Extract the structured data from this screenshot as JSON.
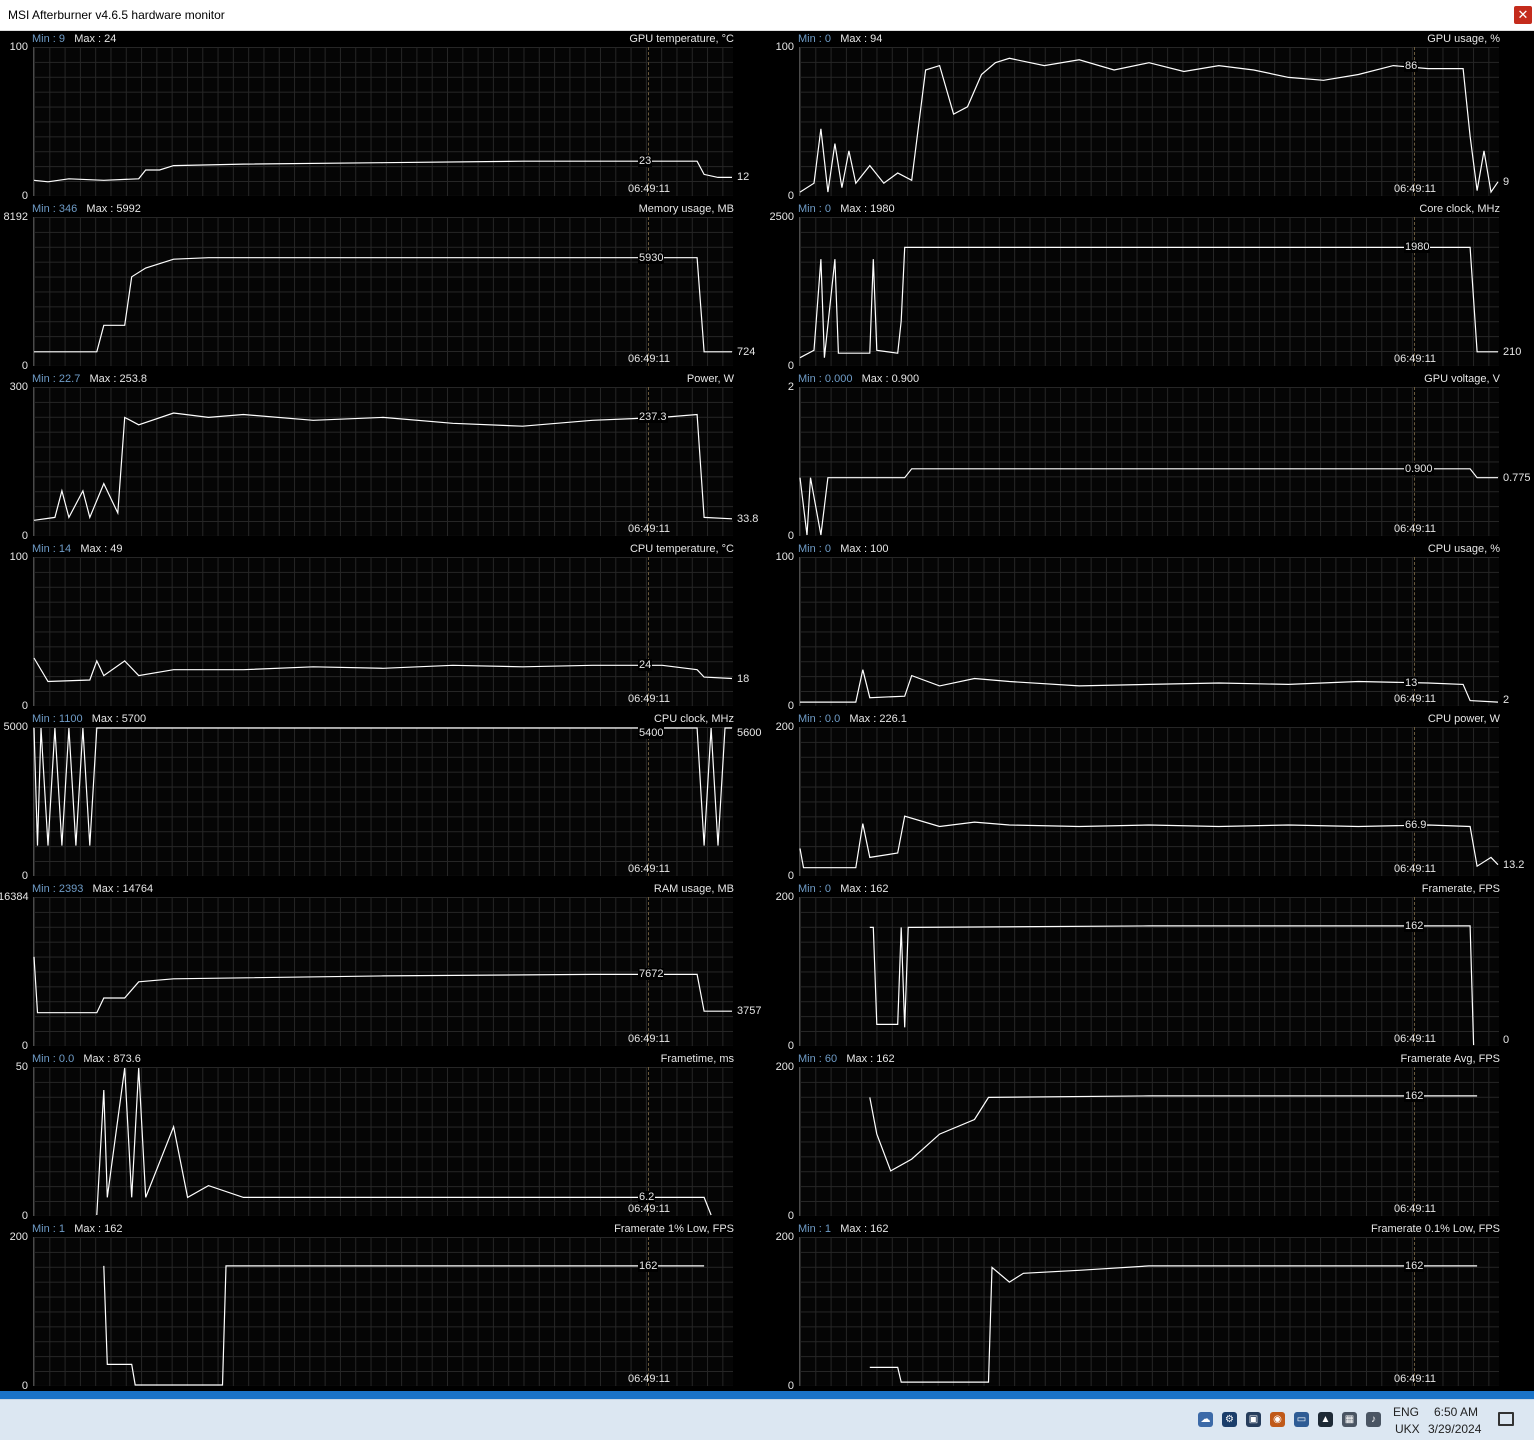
{
  "window": {
    "title": "MSI Afterburner v4.6.5 hardware monitor",
    "close_glyph": "✕"
  },
  "colors": {
    "trace": "#ffffff",
    "minmax_label": "#6f9cc7",
    "text": "#e6e6e6",
    "grid": "#262626",
    "taskbar": "#dce7f2",
    "accent_strip": "#1a73c8"
  },
  "timestamp": "06:49:11",
  "graphs": [
    {
      "title": "GPU temperature, °C",
      "min": "9",
      "max": "24",
      "scale_max": "100",
      "scale_min": "0",
      "current": "23",
      "last": "12",
      "trace": [
        [
          0,
          10
        ],
        [
          0.02,
          9
        ],
        [
          0.05,
          11
        ],
        [
          0.1,
          10
        ],
        [
          0.15,
          11
        ],
        [
          0.16,
          17
        ],
        [
          0.18,
          17
        ],
        [
          0.2,
          20
        ],
        [
          0.3,
          21
        ],
        [
          0.5,
          22
        ],
        [
          0.7,
          23
        ],
        [
          0.88,
          23
        ],
        [
          0.95,
          23
        ],
        [
          0.96,
          14
        ],
        [
          0.98,
          12
        ],
        [
          1,
          12
        ]
      ]
    },
    {
      "title": "GPU usage, %",
      "min": "0",
      "max": "94",
      "scale_max": "100",
      "scale_min": "0",
      "current": "86",
      "last": "9",
      "trace": [
        [
          0,
          2
        ],
        [
          0.02,
          8
        ],
        [
          0.03,
          45
        ],
        [
          0.04,
          2
        ],
        [
          0.05,
          35
        ],
        [
          0.06,
          5
        ],
        [
          0.07,
          30
        ],
        [
          0.08,
          8
        ],
        [
          0.1,
          20
        ],
        [
          0.12,
          8
        ],
        [
          0.14,
          15
        ],
        [
          0.16,
          10
        ],
        [
          0.18,
          85
        ],
        [
          0.2,
          88
        ],
        [
          0.22,
          55
        ],
        [
          0.24,
          60
        ],
        [
          0.26,
          82
        ],
        [
          0.28,
          90
        ],
        [
          0.3,
          93
        ],
        [
          0.35,
          88
        ],
        [
          0.4,
          92
        ],
        [
          0.45,
          85
        ],
        [
          0.5,
          90
        ],
        [
          0.55,
          84
        ],
        [
          0.6,
          88
        ],
        [
          0.65,
          85
        ],
        [
          0.7,
          80
        ],
        [
          0.75,
          78
        ],
        [
          0.8,
          82
        ],
        [
          0.85,
          88
        ],
        [
          0.9,
          86
        ],
        [
          0.95,
          86
        ],
        [
          0.96,
          40
        ],
        [
          0.97,
          3
        ],
        [
          0.98,
          30
        ],
        [
          0.99,
          2
        ],
        [
          1,
          9
        ]
      ]
    },
    {
      "title": "Memory usage, MB",
      "min": "346",
      "max": "5992",
      "scale_max": "8192",
      "scale_min": "0",
      "current": "5930",
      "last": "724",
      "trace": [
        [
          0,
          0.09
        ],
        [
          0.09,
          0.09
        ],
        [
          0.1,
          0.27
        ],
        [
          0.13,
          0.27
        ],
        [
          0.14,
          0.6
        ],
        [
          0.16,
          0.66
        ],
        [
          0.2,
          0.72
        ],
        [
          0.25,
          0.73
        ],
        [
          0.5,
          0.73
        ],
        [
          0.7,
          0.73
        ],
        [
          0.92,
          0.73
        ],
        [
          0.95,
          0.73
        ],
        [
          0.96,
          0.09
        ],
        [
          1,
          0.09
        ]
      ]
    },
    {
      "title": "Core clock, MHz",
      "min": "0",
      "max": "1980",
      "scale_max": "2500",
      "scale_min": "0",
      "current": "1980",
      "last": "210",
      "trace": [
        [
          0,
          0.05
        ],
        [
          0.02,
          0.1
        ],
        [
          0.03,
          0.72
        ],
        [
          0.035,
          0.05
        ],
        [
          0.05,
          0.72
        ],
        [
          0.055,
          0.08
        ],
        [
          0.1,
          0.08
        ],
        [
          0.105,
          0.72
        ],
        [
          0.11,
          0.1
        ],
        [
          0.14,
          0.08
        ],
        [
          0.145,
          0.3
        ],
        [
          0.15,
          0.8
        ],
        [
          0.16,
          0.8
        ],
        [
          0.5,
          0.8
        ],
        [
          0.9,
          0.8
        ],
        [
          0.96,
          0.8
        ],
        [
          0.97,
          0.09
        ],
        [
          1,
          0.09
        ]
      ]
    },
    {
      "title": "Power, W",
      "min": "22.7",
      "max": "253.8",
      "scale_max": "300",
      "scale_min": "0",
      "current": "237.3",
      "last": "33.8",
      "trace": [
        [
          0,
          0.1
        ],
        [
          0.03,
          0.12
        ],
        [
          0.04,
          0.3
        ],
        [
          0.05,
          0.12
        ],
        [
          0.07,
          0.3
        ],
        [
          0.08,
          0.12
        ],
        [
          0.1,
          0.35
        ],
        [
          0.12,
          0.15
        ],
        [
          0.13,
          0.8
        ],
        [
          0.15,
          0.75
        ],
        [
          0.2,
          0.83
        ],
        [
          0.25,
          0.8
        ],
        [
          0.3,
          0.82
        ],
        [
          0.4,
          0.78
        ],
        [
          0.5,
          0.8
        ],
        [
          0.6,
          0.76
        ],
        [
          0.7,
          0.74
        ],
        [
          0.8,
          0.78
        ],
        [
          0.9,
          0.8
        ],
        [
          0.95,
          0.82
        ],
        [
          0.96,
          0.12
        ],
        [
          1,
          0.11
        ]
      ]
    },
    {
      "title": "GPU voltage, V",
      "min": "0.000",
      "max": "0.900",
      "scale_max": "2",
      "scale_min": "0",
      "current": "0.900",
      "last": "0.775",
      "trace": [
        [
          0,
          0.39
        ],
        [
          0.01,
          0.0
        ],
        [
          0.015,
          0.39
        ],
        [
          0.03,
          0.0
        ],
        [
          0.04,
          0.39
        ],
        [
          0.06,
          0.39
        ],
        [
          0.15,
          0.39
        ],
        [
          0.16,
          0.45
        ],
        [
          0.5,
          0.45
        ],
        [
          0.96,
          0.45
        ],
        [
          0.97,
          0.39
        ],
        [
          1,
          0.39
        ]
      ]
    },
    {
      "title": "CPU temperature, °C",
      "min": "14",
      "max": "49",
      "scale_max": "100",
      "scale_min": "0",
      "current": "24",
      "last": "18",
      "trace": [
        [
          0,
          0.32
        ],
        [
          0.02,
          0.16
        ],
        [
          0.08,
          0.17
        ],
        [
          0.09,
          0.3
        ],
        [
          0.1,
          0.2
        ],
        [
          0.13,
          0.3
        ],
        [
          0.15,
          0.2
        ],
        [
          0.2,
          0.24
        ],
        [
          0.3,
          0.24
        ],
        [
          0.4,
          0.26
        ],
        [
          0.5,
          0.25
        ],
        [
          0.6,
          0.27
        ],
        [
          0.7,
          0.26
        ],
        [
          0.8,
          0.27
        ],
        [
          0.9,
          0.27
        ],
        [
          0.95,
          0.24
        ],
        [
          0.96,
          0.19
        ],
        [
          1,
          0.18
        ]
      ]
    },
    {
      "title": "CPU usage, %",
      "min": "0",
      "max": "100",
      "scale_max": "100",
      "scale_min": "0",
      "current": "13",
      "last": "2",
      "trace": [
        [
          0,
          0.02
        ],
        [
          0.08,
          0.02
        ],
        [
          0.09,
          0.24
        ],
        [
          0.1,
          0.05
        ],
        [
          0.15,
          0.06
        ],
        [
          0.16,
          0.2
        ],
        [
          0.2,
          0.13
        ],
        [
          0.25,
          0.18
        ],
        [
          0.3,
          0.16
        ],
        [
          0.4,
          0.13
        ],
        [
          0.5,
          0.14
        ],
        [
          0.6,
          0.15
        ],
        [
          0.7,
          0.14
        ],
        [
          0.8,
          0.16
        ],
        [
          0.9,
          0.15
        ],
        [
          0.95,
          0.14
        ],
        [
          0.96,
          0.03
        ],
        [
          1,
          0.02
        ]
      ]
    },
    {
      "title": "CPU clock, MHz",
      "min": "1100",
      "max": "5700",
      "scale_max": "5000",
      "scale_min": "0",
      "current": "5400",
      "last": "5600",
      "trace": [
        [
          0,
          1
        ],
        [
          0.005,
          0.2
        ],
        [
          0.01,
          1
        ],
        [
          0.02,
          0.2
        ],
        [
          0.03,
          1
        ],
        [
          0.04,
          0.2
        ],
        [
          0.05,
          1
        ],
        [
          0.06,
          0.2
        ],
        [
          0.07,
          1
        ],
        [
          0.08,
          0.2
        ],
        [
          0.09,
          1
        ],
        [
          0.1,
          1
        ],
        [
          0.5,
          1
        ],
        [
          0.95,
          1
        ],
        [
          0.96,
          0.2
        ],
        [
          0.97,
          1
        ],
        [
          0.98,
          0.2
        ],
        [
          0.99,
          1
        ],
        [
          1,
          1
        ]
      ]
    },
    {
      "title": "CPU power, W",
      "min": "0.0",
      "max": "226.1",
      "scale_max": "200",
      "scale_min": "0",
      "current": "66.9",
      "last": "13.2",
      "trace": [
        [
          0,
          0.18
        ],
        [
          0.005,
          0.05
        ],
        [
          0.08,
          0.05
        ],
        [
          0.09,
          0.35
        ],
        [
          0.1,
          0.12
        ],
        [
          0.14,
          0.15
        ],
        [
          0.15,
          0.4
        ],
        [
          0.2,
          0.33
        ],
        [
          0.25,
          0.36
        ],
        [
          0.3,
          0.34
        ],
        [
          0.4,
          0.33
        ],
        [
          0.5,
          0.34
        ],
        [
          0.6,
          0.33
        ],
        [
          0.7,
          0.34
        ],
        [
          0.8,
          0.33
        ],
        [
          0.9,
          0.34
        ],
        [
          0.96,
          0.33
        ],
        [
          0.97,
          0.06
        ],
        [
          0.99,
          0.12
        ],
        [
          1,
          0.07
        ]
      ]
    },
    {
      "title": "RAM usage, MB",
      "min": "2393",
      "max": "14764",
      "scale_max": "16384",
      "scale_min": "0",
      "current": "7672",
      "last": "3757",
      "trace": [
        [
          0,
          0.6
        ],
        [
          0.005,
          0.22
        ],
        [
          0.09,
          0.22
        ],
        [
          0.1,
          0.32
        ],
        [
          0.13,
          0.32
        ],
        [
          0.15,
          0.43
        ],
        [
          0.2,
          0.45
        ],
        [
          0.5,
          0.47
        ],
        [
          0.8,
          0.48
        ],
        [
          0.95,
          0.48
        ],
        [
          0.96,
          0.23
        ],
        [
          1,
          0.23
        ]
      ]
    },
    {
      "title": "Framerate, FPS",
      "min": "0",
      "max": "162",
      "scale_max": "200",
      "scale_min": "0",
      "current": "162",
      "last": "0",
      "trace": [
        [
          0.1,
          0.8
        ],
        [
          0.105,
          0.8
        ],
        [
          0.11,
          0.14
        ],
        [
          0.14,
          0.14
        ],
        [
          0.145,
          0.8
        ],
        [
          0.15,
          0.12
        ],
        [
          0.155,
          0.8
        ],
        [
          0.16,
          0.8
        ],
        [
          0.5,
          0.81
        ],
        [
          0.9,
          0.81
        ],
        [
          0.96,
          0.81
        ],
        [
          0.965,
          0.0
        ]
      ]
    },
    {
      "title": "Frametime, ms",
      "min": "0.0",
      "max": "873.6",
      "scale_max": "50",
      "scale_min": "0",
      "current": "6.2",
      "last": "",
      "trace": [
        [
          0.09,
          0.0
        ],
        [
          0.1,
          0.85
        ],
        [
          0.105,
          0.12
        ],
        [
          0.13,
          1
        ],
        [
          0.14,
          0.12
        ],
        [
          0.15,
          1
        ],
        [
          0.16,
          0.12
        ],
        [
          0.2,
          0.6
        ],
        [
          0.22,
          0.12
        ],
        [
          0.25,
          0.2
        ],
        [
          0.3,
          0.12
        ],
        [
          0.5,
          0.12
        ],
        [
          0.8,
          0.12
        ],
        [
          0.96,
          0.12
        ],
        [
          0.97,
          0.0
        ]
      ]
    },
    {
      "title": "Framerate Avg, FPS",
      "min": "60",
      "max": "162",
      "scale_max": "200",
      "scale_min": "0",
      "current": "162",
      "last": "",
      "trace": [
        [
          0.1,
          0.8
        ],
        [
          0.11,
          0.55
        ],
        [
          0.13,
          0.3
        ],
        [
          0.16,
          0.38
        ],
        [
          0.2,
          0.55
        ],
        [
          0.25,
          0.65
        ],
        [
          0.27,
          0.8
        ],
        [
          0.5,
          0.81
        ],
        [
          0.97,
          0.81
        ]
      ]
    },
    {
      "title": "Framerate 1% Low, FPS",
      "min": "1",
      "max": "162",
      "scale_max": "200",
      "scale_min": "0",
      "current": "162",
      "last": "",
      "trace": [
        [
          0.1,
          0.81
        ],
        [
          0.105,
          0.14
        ],
        [
          0.14,
          0.14
        ],
        [
          0.145,
          0.0
        ],
        [
          0.27,
          0.0
        ],
        [
          0.275,
          0.81
        ],
        [
          0.96,
          0.81
        ]
      ]
    },
    {
      "title": "Framerate 0.1% Low, FPS",
      "min": "1",
      "max": "162",
      "scale_max": "200",
      "scale_min": "0",
      "current": "162",
      "last": "",
      "trace": [
        [
          0.1,
          0.12
        ],
        [
          0.14,
          0.12
        ],
        [
          0.145,
          0.02
        ],
        [
          0.27,
          0.02
        ],
        [
          0.275,
          0.8
        ],
        [
          0.3,
          0.7
        ],
        [
          0.32,
          0.76
        ],
        [
          0.4,
          0.78
        ],
        [
          0.5,
          0.81
        ],
        [
          0.97,
          0.81
        ]
      ]
    }
  ],
  "taskbar": {
    "lang": "ENG",
    "layout": "UKX",
    "time": "6:50 AM",
    "date": "3/29/2024",
    "tray_icons": [
      "network-cloud-icon",
      "steam-icon",
      "monitor-icon",
      "msi-afterburner-icon",
      "drive-icon",
      "nvidia-icon",
      "network-icon",
      "speaker-icon"
    ]
  }
}
